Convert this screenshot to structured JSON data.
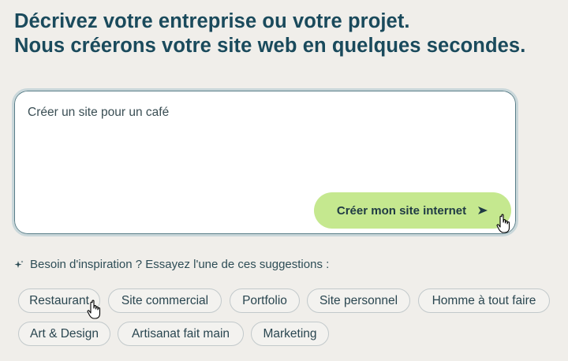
{
  "headline": {
    "line1": "Décrivez votre entreprise ou votre projet.",
    "line2": "Nous créerons votre site web en quelques secondes."
  },
  "prompt": {
    "value": "Créer un site pour un café"
  },
  "create_button": {
    "label": "Créer mon site internet",
    "color": "#c5e88f"
  },
  "inspiration": {
    "text": "Besoin d'inspiration ? Essayez l'une de ces suggestions :"
  },
  "suggestions": [
    "Restaurant",
    "Site commercial",
    "Portfolio",
    "Site personnel",
    "Homme à tout faire",
    "Art & Design",
    "Artisanat fait main",
    "Marketing"
  ],
  "colors": {
    "background": "#f0eeea",
    "heading": "#1a4a5c",
    "accent_button": "#c5e88f"
  },
  "icons": {
    "button_icon": "send-arrow-icon",
    "inspiration_icon": "sparkle-icon",
    "cursor": "hand-pointer-icon"
  }
}
